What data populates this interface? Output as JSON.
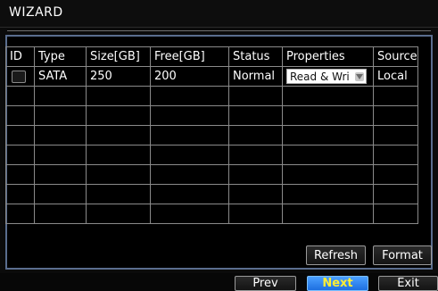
{
  "window": {
    "title": "WIZARD"
  },
  "table": {
    "headers": [
      "ID",
      "Type",
      "Size[GB]",
      "Free[GB]",
      "Status",
      "Properties",
      "Source"
    ],
    "rows": [
      {
        "type": "SATA",
        "size": "250",
        "free": "200",
        "status": "Normal",
        "properties": "Read & Wri",
        "source": "Local"
      }
    ]
  },
  "buttons": {
    "refresh": "Refresh",
    "format": "Format",
    "prev": "Prev",
    "next": "Next",
    "exit": "Exit"
  },
  "colors": {
    "accent_blue": "#2f86f0",
    "next_text": "#ffee33",
    "panel_border": "#5a6d8e"
  }
}
